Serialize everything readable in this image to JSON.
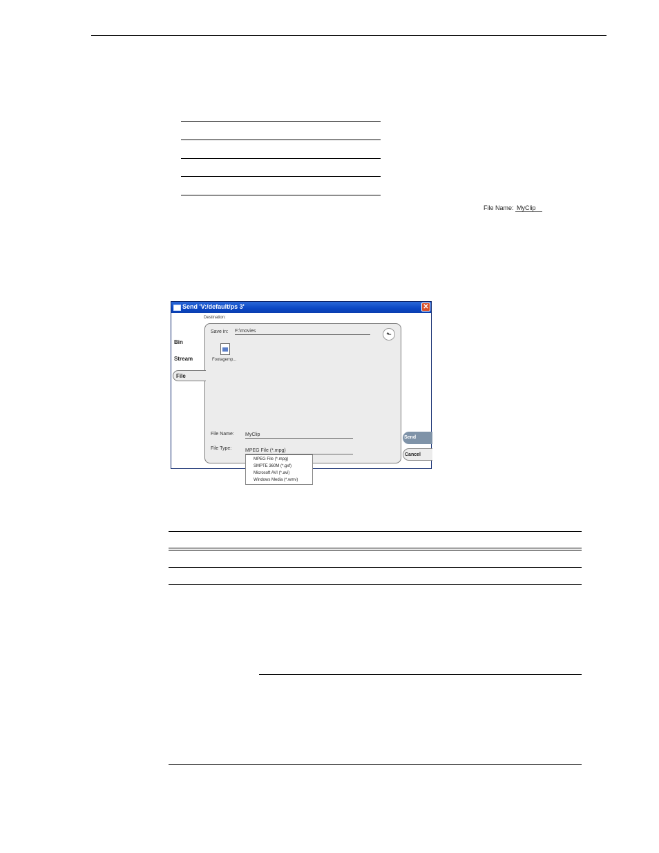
{
  "inline_field": {
    "label": "File Name:",
    "value": "MyClip"
  },
  "dialog": {
    "title": "Send 'V:/default/ps 3'",
    "close_glyph": "✕",
    "destination_label": "Destination:",
    "tabs": [
      "Bin",
      "Stream",
      "File"
    ],
    "selected_tab": "File",
    "save_in": {
      "label": "Save in:",
      "value": "F:\\movies"
    },
    "up_glyph": "⬑",
    "file_item": {
      "label": "Footagemp..."
    },
    "file_name": {
      "label": "File Name:",
      "value": "MyClip"
    },
    "file_type": {
      "label": "File Type:",
      "value": "MPEG File (*.mpg)"
    },
    "buttons": {
      "send": "Send",
      "cancel": "Cancel"
    },
    "file_type_options": [
      "MPEG File (*.mpg)",
      "SMPTE 360M (*.gxf)",
      "Microsoft AVI (*.avi)",
      "Windows Media (*.wmv)"
    ]
  }
}
